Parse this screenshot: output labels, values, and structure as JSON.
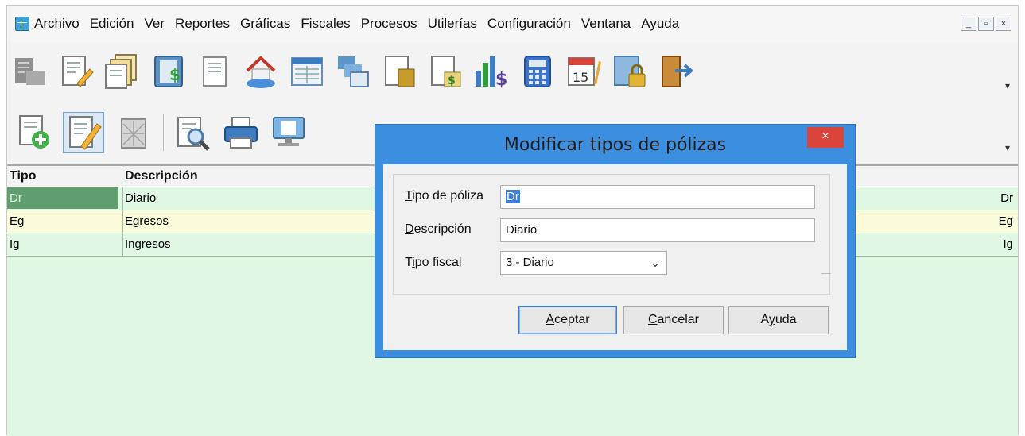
{
  "menu": {
    "items": [
      {
        "pre": "",
        "ul": "A",
        "post": "rchivo"
      },
      {
        "pre": "E",
        "ul": "d",
        "post": "ición"
      },
      {
        "pre": "V",
        "ul": "e",
        "post": "r"
      },
      {
        "pre": "",
        "ul": "R",
        "post": "eportes"
      },
      {
        "pre": "",
        "ul": "G",
        "post": "ráficas"
      },
      {
        "pre": "F",
        "ul": "i",
        "post": "scales"
      },
      {
        "pre": "",
        "ul": "P",
        "post": "rocesos"
      },
      {
        "pre": "",
        "ul": "U",
        "post": "tilerías"
      },
      {
        "pre": "Con",
        "ul": "f",
        "post": "iguración"
      },
      {
        "pre": "Ve",
        "ul": "n",
        "post": "tana"
      },
      {
        "pre": "A",
        "ul": "y",
        "post": "uda"
      }
    ],
    "window_controls": [
      "_",
      "▫",
      "×"
    ]
  },
  "toolbar1": {
    "icons": [
      "catalog-icon",
      "notes-icon",
      "documents-icon",
      "ledger-icon",
      "page-icon",
      "home-icon",
      "calendar-table-icon",
      "reports-icon",
      "folder-doc-icon",
      "money-doc-icon",
      "chart-money-icon",
      "calculator-icon",
      "calendar-icon",
      "lock-icon",
      "exit-door-icon"
    ],
    "calendar_day": "15"
  },
  "toolbar2": {
    "icons": [
      "add-record-icon",
      "edit-record-icon",
      "delete-record-icon",
      "preview-icon",
      "print-icon",
      "screen-icon"
    ],
    "more_glyph": "▾"
  },
  "grid": {
    "headers": {
      "type": "Tipo",
      "description": "Descripción"
    },
    "rows": [
      {
        "type": "Dr",
        "description": "Diario",
        "right": "Dr"
      },
      {
        "type": "Eg",
        "description": "Egresos",
        "right": "Eg"
      },
      {
        "type": "Ig",
        "description": "Ingresos",
        "right": "Ig"
      }
    ]
  },
  "dialog": {
    "title": "Modificar tipos de pólizas",
    "close": "×",
    "fields": {
      "tipo_label_ul": "T",
      "tipo_label_rest": "ipo de póliza",
      "tipo_value": "Dr",
      "desc_label_ul": "D",
      "desc_label_rest": "escripción",
      "desc_value": "Diario",
      "fiscal_label_pre": "T",
      "fiscal_label_ul": "i",
      "fiscal_label_rest": "po fiscal",
      "fiscal_value": "3.- Diario",
      "fiscal_arrow": "⌄"
    },
    "buttons": {
      "accept_ul": "A",
      "accept_rest": "ceptar",
      "cancel_ul": "C",
      "cancel_rest": "ancelar",
      "help_pre": "A",
      "help_ul": "y",
      "help_rest": "uda"
    }
  },
  "colors": {
    "grid_bg": "#dff7e3",
    "selected_row": "#5f9e6e",
    "highlight_row": "#fbfbdc",
    "dialog_frame": "#3c8fe0",
    "close_button": "#d9453b"
  }
}
